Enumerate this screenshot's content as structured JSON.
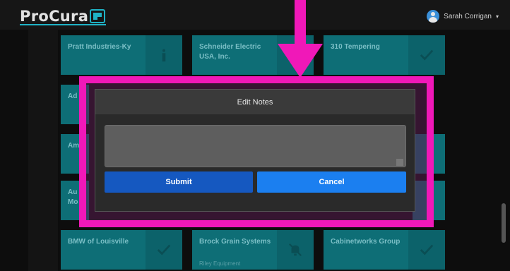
{
  "header": {
    "logo_text": "ProCura",
    "user_name": "Sarah Corrigan",
    "caret": "▾"
  },
  "cards": [
    {
      "name": "Pratt Industries-Ky",
      "sub": "",
      "icon": "info-icon"
    },
    {
      "name": "Schneider Electric USA, Inc.",
      "sub": "",
      "icon": "check-icon"
    },
    {
      "name": "310 Tempering",
      "sub": "",
      "icon": "check-icon"
    },
    {
      "name": "Ad",
      "sub": "",
      "icon": ""
    },
    {
      "name": "Am",
      "sub": "",
      "icon": ""
    },
    {
      "name": "Au",
      "sub": "",
      "icon": ""
    },
    {
      "name": "Mo",
      "sub": "",
      "icon": ""
    },
    {
      "name": "BMW of Louisville",
      "sub": "",
      "icon": "check-icon"
    },
    {
      "name": "Brock Grain Systems",
      "sub": "Riley Equipment",
      "icon": "bell-off-icon"
    },
    {
      "name": "Cabinetworks Group",
      "sub": "",
      "icon": "check-icon"
    }
  ],
  "modal": {
    "title": "Edit Notes",
    "notes_value": "",
    "submit_label": "Submit",
    "cancel_label": "Cancel"
  },
  "colors": {
    "highlight": "#f018b8",
    "card": "#0e6e76",
    "submit": "#1558c0",
    "cancel": "#1b7ff0"
  }
}
